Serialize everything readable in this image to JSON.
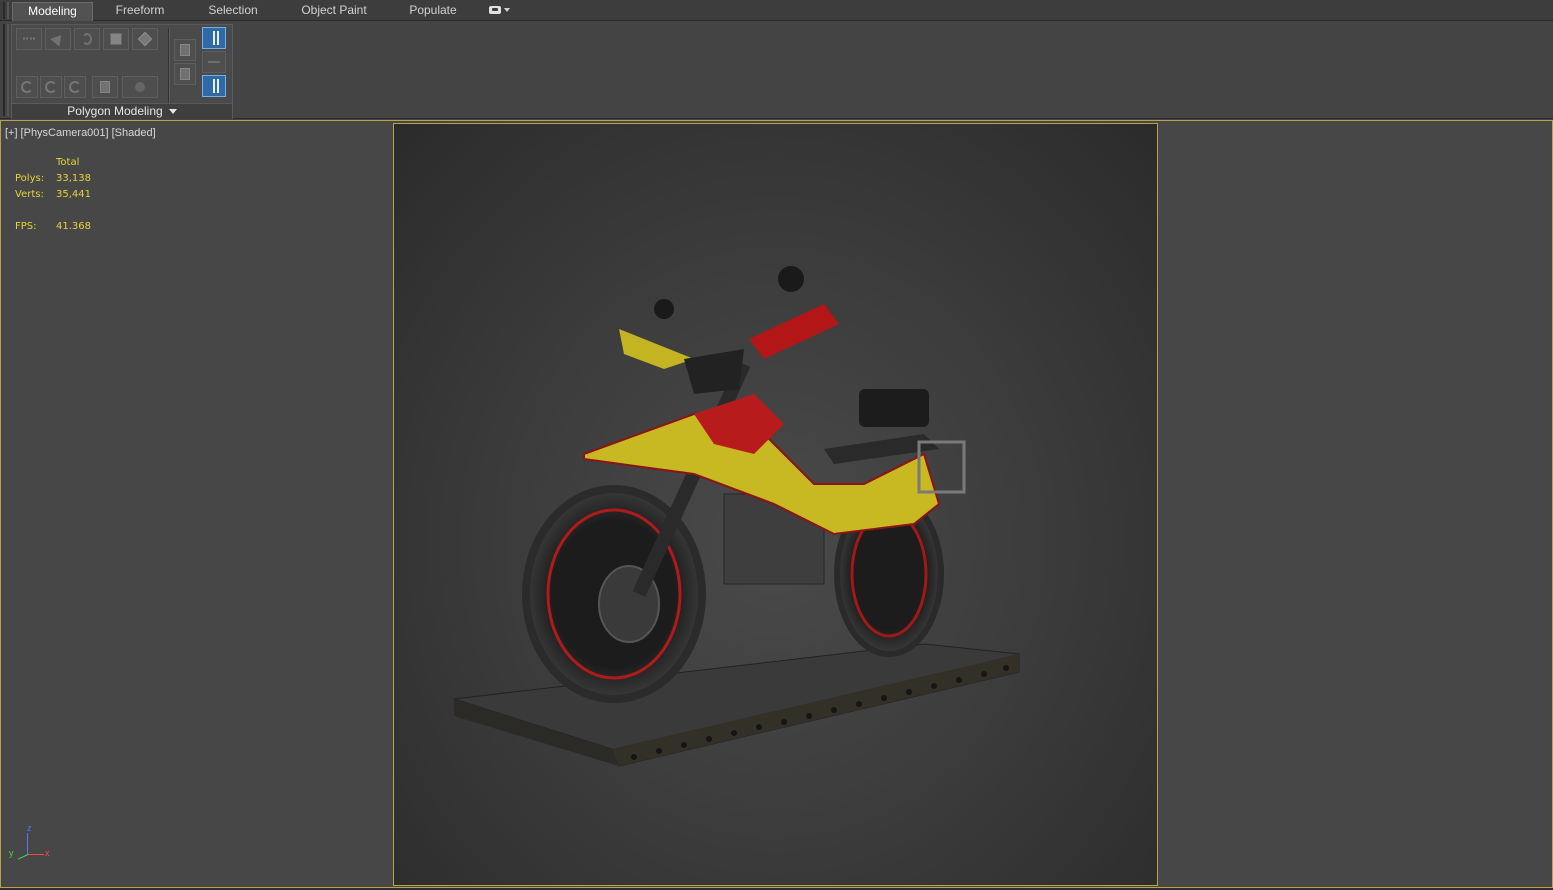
{
  "ribbon": {
    "tabs": [
      {
        "label": "Modeling",
        "active": true
      },
      {
        "label": "Freeform",
        "active": false
      },
      {
        "label": "Selection",
        "active": false
      },
      {
        "label": "Object Paint",
        "active": false
      },
      {
        "label": "Populate",
        "active": false
      }
    ],
    "options_icon": "display-options-icon",
    "panel_title": "Polygon Modeling",
    "panel_buttons_row1": [
      "vertex-icon",
      "edge-icon",
      "border-icon",
      "polygon-icon",
      "element-icon"
    ],
    "panel_buttons_row2": [
      "previous-modifier-icon",
      "next-modifier-icon",
      "modify-mode-icon",
      "use-nurms-icon",
      "sub-object-off-icon"
    ],
    "panel_side_buttons": [
      "collapse-stack-icon",
      "toggle-command-mode-icon",
      "show-end-result-icon",
      "pin-stack-icon",
      "modify-mode-active-icon"
    ]
  },
  "viewport": {
    "label_plus": "[+]",
    "label_camera": "[PhysCamera001]",
    "label_shading": "[Shaded]",
    "stats": {
      "header": "Total",
      "polys_label": "Polys:",
      "polys_value": "33,138",
      "verts_label": "Verts:",
      "verts_value": "35,441",
      "fps_label": "FPS:",
      "fps_value": "41.368"
    },
    "axis": {
      "x": "x",
      "y": "y",
      "z": "z"
    },
    "colors": {
      "border": "#b8a24a",
      "stats_text": "#e4d33a"
    }
  }
}
